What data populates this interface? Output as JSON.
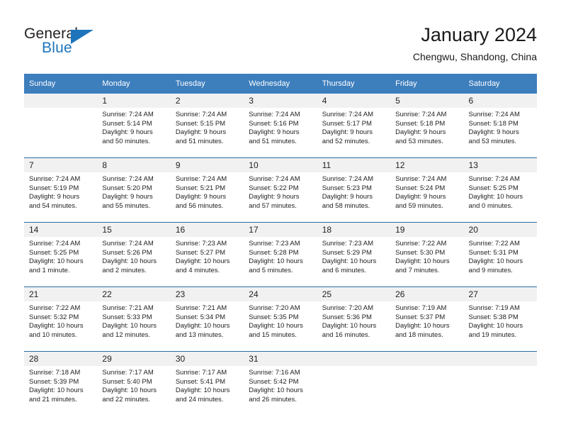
{
  "brand": {
    "name_part1": "General",
    "name_part2": "Blue",
    "colors": {
      "dark": "#231f20",
      "blue": "#1d74bb"
    }
  },
  "header": {
    "title": "January 2024",
    "subtitle": "Chengwu, Shandong, China"
  },
  "theme": {
    "header_bg": "#3d7ebd",
    "row_divider": "#2b6ca3",
    "datenum_bg": "#f1f1f1"
  },
  "weekdays": [
    "Sunday",
    "Monday",
    "Tuesday",
    "Wednesday",
    "Thursday",
    "Friday",
    "Saturday"
  ],
  "weeks": [
    [
      {
        "day": "",
        "sunrise": "",
        "sunset": "",
        "daylight1": "",
        "daylight2": ""
      },
      {
        "day": "1",
        "sunrise": "Sunrise: 7:24 AM",
        "sunset": "Sunset: 5:14 PM",
        "daylight1": "Daylight: 9 hours",
        "daylight2": "and 50 minutes."
      },
      {
        "day": "2",
        "sunrise": "Sunrise: 7:24 AM",
        "sunset": "Sunset: 5:15 PM",
        "daylight1": "Daylight: 9 hours",
        "daylight2": "and 51 minutes."
      },
      {
        "day": "3",
        "sunrise": "Sunrise: 7:24 AM",
        "sunset": "Sunset: 5:16 PM",
        "daylight1": "Daylight: 9 hours",
        "daylight2": "and 51 minutes."
      },
      {
        "day": "4",
        "sunrise": "Sunrise: 7:24 AM",
        "sunset": "Sunset: 5:17 PM",
        "daylight1": "Daylight: 9 hours",
        "daylight2": "and 52 minutes."
      },
      {
        "day": "5",
        "sunrise": "Sunrise: 7:24 AM",
        "sunset": "Sunset: 5:18 PM",
        "daylight1": "Daylight: 9 hours",
        "daylight2": "and 53 minutes."
      },
      {
        "day": "6",
        "sunrise": "Sunrise: 7:24 AM",
        "sunset": "Sunset: 5:18 PM",
        "daylight1": "Daylight: 9 hours",
        "daylight2": "and 53 minutes."
      }
    ],
    [
      {
        "day": "7",
        "sunrise": "Sunrise: 7:24 AM",
        "sunset": "Sunset: 5:19 PM",
        "daylight1": "Daylight: 9 hours",
        "daylight2": "and 54 minutes."
      },
      {
        "day": "8",
        "sunrise": "Sunrise: 7:24 AM",
        "sunset": "Sunset: 5:20 PM",
        "daylight1": "Daylight: 9 hours",
        "daylight2": "and 55 minutes."
      },
      {
        "day": "9",
        "sunrise": "Sunrise: 7:24 AM",
        "sunset": "Sunset: 5:21 PM",
        "daylight1": "Daylight: 9 hours",
        "daylight2": "and 56 minutes."
      },
      {
        "day": "10",
        "sunrise": "Sunrise: 7:24 AM",
        "sunset": "Sunset: 5:22 PM",
        "daylight1": "Daylight: 9 hours",
        "daylight2": "and 57 minutes."
      },
      {
        "day": "11",
        "sunrise": "Sunrise: 7:24 AM",
        "sunset": "Sunset: 5:23 PM",
        "daylight1": "Daylight: 9 hours",
        "daylight2": "and 58 minutes."
      },
      {
        "day": "12",
        "sunrise": "Sunrise: 7:24 AM",
        "sunset": "Sunset: 5:24 PM",
        "daylight1": "Daylight: 9 hours",
        "daylight2": "and 59 minutes."
      },
      {
        "day": "13",
        "sunrise": "Sunrise: 7:24 AM",
        "sunset": "Sunset: 5:25 PM",
        "daylight1": "Daylight: 10 hours",
        "daylight2": "and 0 minutes."
      }
    ],
    [
      {
        "day": "14",
        "sunrise": "Sunrise: 7:24 AM",
        "sunset": "Sunset: 5:25 PM",
        "daylight1": "Daylight: 10 hours",
        "daylight2": "and 1 minute."
      },
      {
        "day": "15",
        "sunrise": "Sunrise: 7:24 AM",
        "sunset": "Sunset: 5:26 PM",
        "daylight1": "Daylight: 10 hours",
        "daylight2": "and 2 minutes."
      },
      {
        "day": "16",
        "sunrise": "Sunrise: 7:23 AM",
        "sunset": "Sunset: 5:27 PM",
        "daylight1": "Daylight: 10 hours",
        "daylight2": "and 4 minutes."
      },
      {
        "day": "17",
        "sunrise": "Sunrise: 7:23 AM",
        "sunset": "Sunset: 5:28 PM",
        "daylight1": "Daylight: 10 hours",
        "daylight2": "and 5 minutes."
      },
      {
        "day": "18",
        "sunrise": "Sunrise: 7:23 AM",
        "sunset": "Sunset: 5:29 PM",
        "daylight1": "Daylight: 10 hours",
        "daylight2": "and 6 minutes."
      },
      {
        "day": "19",
        "sunrise": "Sunrise: 7:22 AM",
        "sunset": "Sunset: 5:30 PM",
        "daylight1": "Daylight: 10 hours",
        "daylight2": "and 7 minutes."
      },
      {
        "day": "20",
        "sunrise": "Sunrise: 7:22 AM",
        "sunset": "Sunset: 5:31 PM",
        "daylight1": "Daylight: 10 hours",
        "daylight2": "and 9 minutes."
      }
    ],
    [
      {
        "day": "21",
        "sunrise": "Sunrise: 7:22 AM",
        "sunset": "Sunset: 5:32 PM",
        "daylight1": "Daylight: 10 hours",
        "daylight2": "and 10 minutes."
      },
      {
        "day": "22",
        "sunrise": "Sunrise: 7:21 AM",
        "sunset": "Sunset: 5:33 PM",
        "daylight1": "Daylight: 10 hours",
        "daylight2": "and 12 minutes."
      },
      {
        "day": "23",
        "sunrise": "Sunrise: 7:21 AM",
        "sunset": "Sunset: 5:34 PM",
        "daylight1": "Daylight: 10 hours",
        "daylight2": "and 13 minutes."
      },
      {
        "day": "24",
        "sunrise": "Sunrise: 7:20 AM",
        "sunset": "Sunset: 5:35 PM",
        "daylight1": "Daylight: 10 hours",
        "daylight2": "and 15 minutes."
      },
      {
        "day": "25",
        "sunrise": "Sunrise: 7:20 AM",
        "sunset": "Sunset: 5:36 PM",
        "daylight1": "Daylight: 10 hours",
        "daylight2": "and 16 minutes."
      },
      {
        "day": "26",
        "sunrise": "Sunrise: 7:19 AM",
        "sunset": "Sunset: 5:37 PM",
        "daylight1": "Daylight: 10 hours",
        "daylight2": "and 18 minutes."
      },
      {
        "day": "27",
        "sunrise": "Sunrise: 7:19 AM",
        "sunset": "Sunset: 5:38 PM",
        "daylight1": "Daylight: 10 hours",
        "daylight2": "and 19 minutes."
      }
    ],
    [
      {
        "day": "28",
        "sunrise": "Sunrise: 7:18 AM",
        "sunset": "Sunset: 5:39 PM",
        "daylight1": "Daylight: 10 hours",
        "daylight2": "and 21 minutes."
      },
      {
        "day": "29",
        "sunrise": "Sunrise: 7:17 AM",
        "sunset": "Sunset: 5:40 PM",
        "daylight1": "Daylight: 10 hours",
        "daylight2": "and 22 minutes."
      },
      {
        "day": "30",
        "sunrise": "Sunrise: 7:17 AM",
        "sunset": "Sunset: 5:41 PM",
        "daylight1": "Daylight: 10 hours",
        "daylight2": "and 24 minutes."
      },
      {
        "day": "31",
        "sunrise": "Sunrise: 7:16 AM",
        "sunset": "Sunset: 5:42 PM",
        "daylight1": "Daylight: 10 hours",
        "daylight2": "and 26 minutes."
      },
      {
        "day": "",
        "sunrise": "",
        "sunset": "",
        "daylight1": "",
        "daylight2": ""
      },
      {
        "day": "",
        "sunrise": "",
        "sunset": "",
        "daylight1": "",
        "daylight2": ""
      },
      {
        "day": "",
        "sunrise": "",
        "sunset": "",
        "daylight1": "",
        "daylight2": ""
      }
    ]
  ]
}
